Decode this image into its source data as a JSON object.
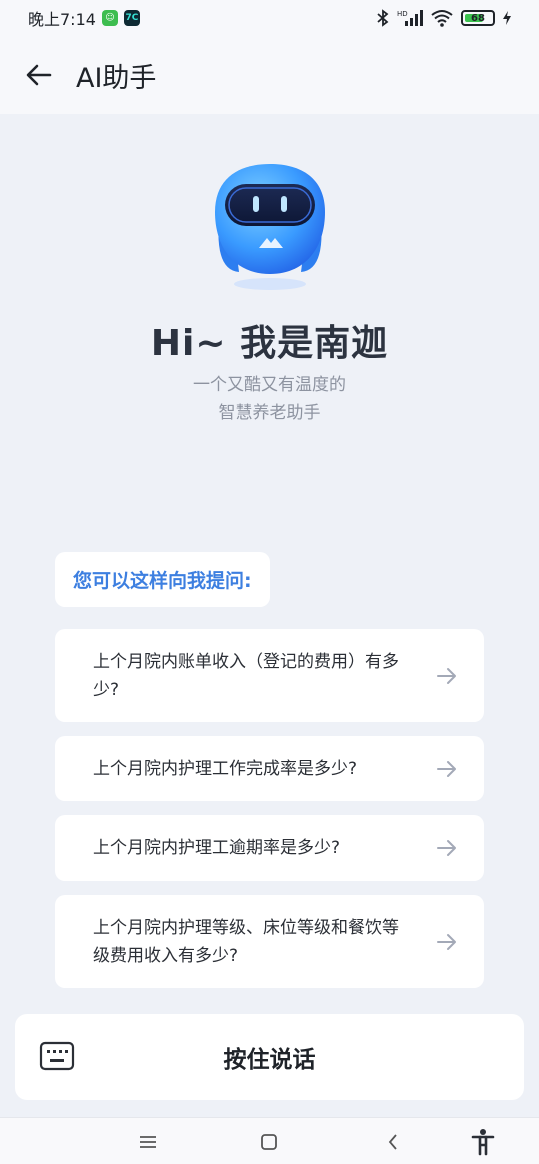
{
  "status_bar": {
    "time": "晚上7:14",
    "battery": "68"
  },
  "header": {
    "title": "AI助手"
  },
  "hero": {
    "title": "Hi~ 我是南迦",
    "subtitle_line1": "一个又酷又有温度的",
    "subtitle_line2": "智慧养老助手"
  },
  "prompt": {
    "label": "您可以这样向我提问:"
  },
  "questions": [
    {
      "text": "上个月院内账单收入（登记的费用）有多少?"
    },
    {
      "text": "上个月院内护理工作完成率是多少?"
    },
    {
      "text": "上个月院内护理工逾期率是多少?"
    },
    {
      "text": "上个月院内护理等级、床位等级和餐饮等级费用收入有多少?"
    }
  ],
  "voice": {
    "label": "按住说话"
  },
  "colors": {
    "accent": "#3d7fe0",
    "background": "#eef1f7",
    "card": "#ffffff"
  }
}
